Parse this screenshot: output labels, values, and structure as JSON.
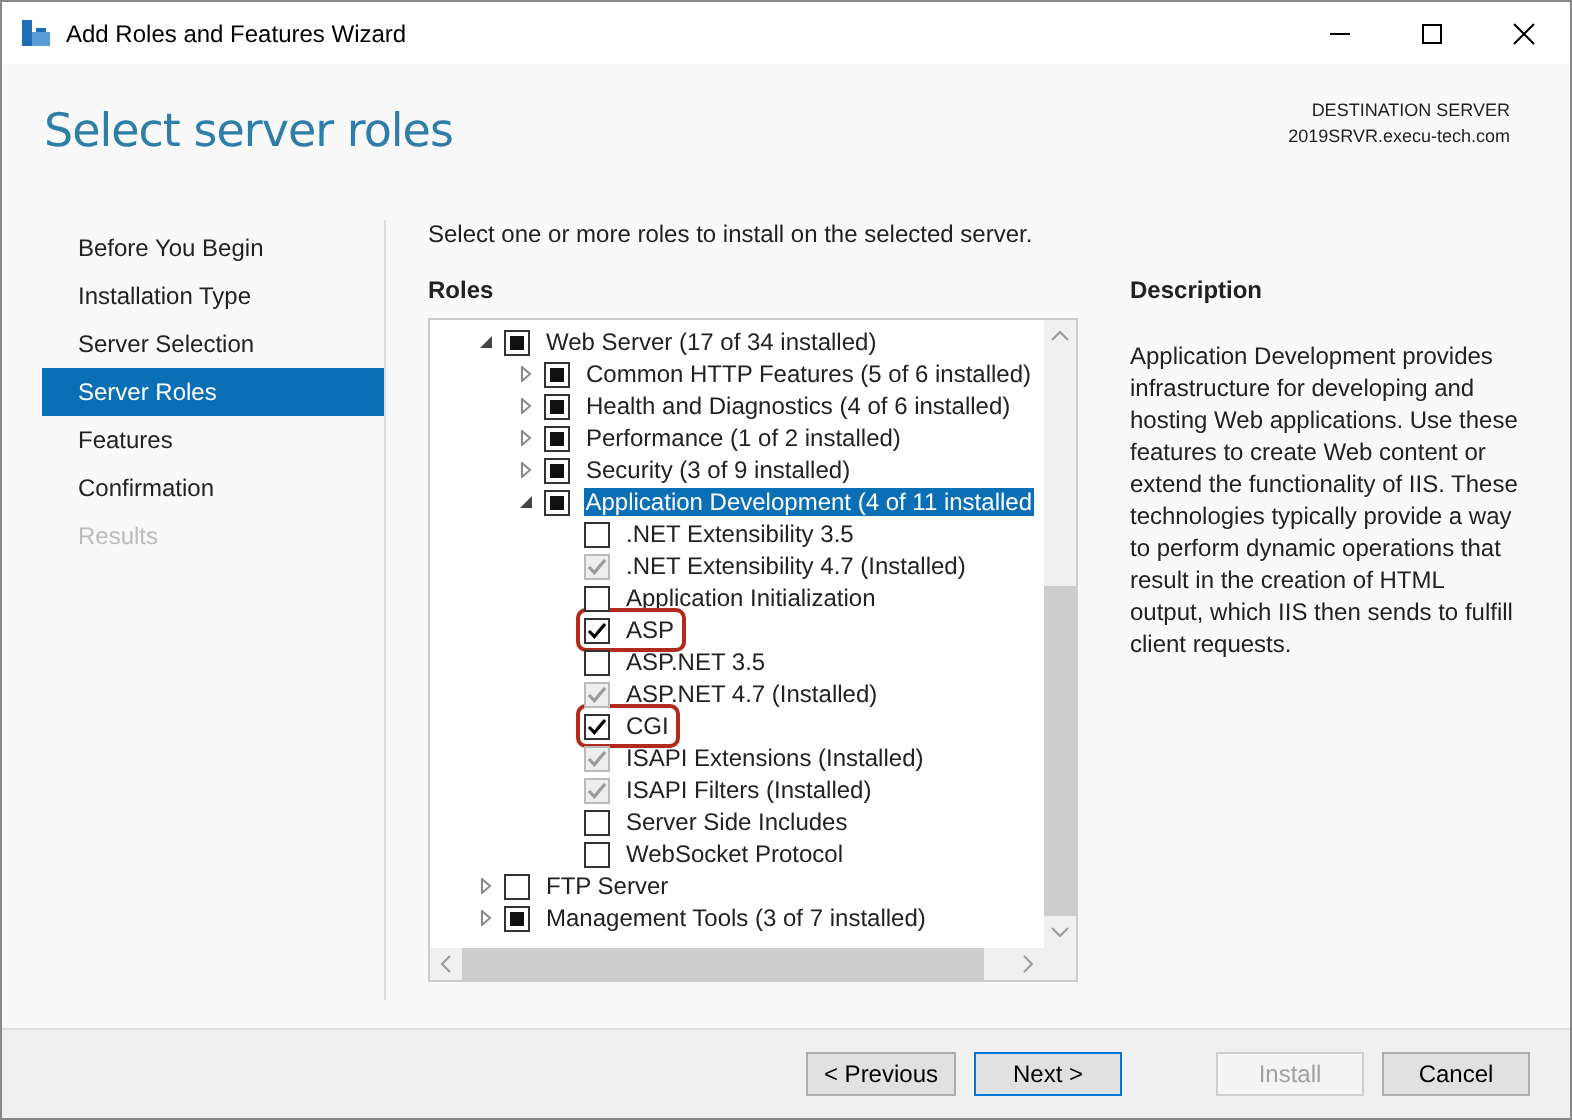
{
  "window": {
    "title": "Add Roles and Features Wizard"
  },
  "header": {
    "title": "Select server roles",
    "destination_label": "DESTINATION SERVER",
    "destination_server": "2019SRVR.execu-tech.com"
  },
  "sidebar": {
    "items": [
      {
        "label": "Before You Begin",
        "selected": false,
        "disabled": false
      },
      {
        "label": "Installation Type",
        "selected": false,
        "disabled": false
      },
      {
        "label": "Server Selection",
        "selected": false,
        "disabled": false
      },
      {
        "label": "Server Roles",
        "selected": true,
        "disabled": false
      },
      {
        "label": "Features",
        "selected": false,
        "disabled": false
      },
      {
        "label": "Confirmation",
        "selected": false,
        "disabled": false
      },
      {
        "label": "Results",
        "selected": false,
        "disabled": true
      }
    ]
  },
  "instruction": "Select one or more roles to install on the selected server.",
  "roles": {
    "heading": "Roles",
    "tree": [
      {
        "label": "Web Server (17 of 34 installed)",
        "checked": false,
        "indeterminate": true,
        "disabled": false,
        "expanded": true,
        "selected": false,
        "highlighted": false,
        "children": [
          {
            "label": "Common HTTP Features (5 of 6 installed)",
            "checked": false,
            "indeterminate": true,
            "disabled": false,
            "expanded": false,
            "selected": false,
            "highlighted": false
          },
          {
            "label": "Health and Diagnostics (4 of 6 installed)",
            "checked": false,
            "indeterminate": true,
            "disabled": false,
            "expanded": false,
            "selected": false,
            "highlighted": false
          },
          {
            "label": "Performance (1 of 2 installed)",
            "checked": false,
            "indeterminate": true,
            "disabled": false,
            "expanded": false,
            "selected": false,
            "highlighted": false
          },
          {
            "label": "Security (3 of 9 installed)",
            "checked": false,
            "indeterminate": true,
            "disabled": false,
            "expanded": false,
            "selected": false,
            "highlighted": false
          },
          {
            "label": "Application Development (4 of 11 installed",
            "checked": false,
            "indeterminate": true,
            "disabled": false,
            "expanded": true,
            "selected": true,
            "highlighted": false,
            "children": [
              {
                "label": ".NET Extensibility 3.5",
                "checked": false,
                "indeterminate": false,
                "disabled": false,
                "selected": false,
                "highlighted": false
              },
              {
                "label": ".NET Extensibility 4.7 (Installed)",
                "checked": true,
                "indeterminate": false,
                "disabled": true,
                "selected": false,
                "highlighted": false
              },
              {
                "label": "Application Initialization",
                "checked": false,
                "indeterminate": false,
                "disabled": false,
                "selected": false,
                "highlighted": false
              },
              {
                "label": "ASP",
                "checked": true,
                "indeterminate": false,
                "disabled": false,
                "selected": false,
                "highlighted": true
              },
              {
                "label": "ASP.NET 3.5",
                "checked": false,
                "indeterminate": false,
                "disabled": false,
                "selected": false,
                "highlighted": false
              },
              {
                "label": "ASP.NET 4.7 (Installed)",
                "checked": true,
                "indeterminate": false,
                "disabled": true,
                "selected": false,
                "highlighted": false
              },
              {
                "label": "CGI",
                "checked": true,
                "indeterminate": false,
                "disabled": false,
                "selected": false,
                "highlighted": true
              },
              {
                "label": "ISAPI Extensions (Installed)",
                "checked": true,
                "indeterminate": false,
                "disabled": true,
                "selected": false,
                "highlighted": false
              },
              {
                "label": "ISAPI Filters (Installed)",
                "checked": true,
                "indeterminate": false,
                "disabled": true,
                "selected": false,
                "highlighted": false
              },
              {
                "label": "Server Side Includes",
                "checked": false,
                "indeterminate": false,
                "disabled": false,
                "selected": false,
                "highlighted": false
              },
              {
                "label": "WebSocket Protocol",
                "checked": false,
                "indeterminate": false,
                "disabled": false,
                "selected": false,
                "highlighted": false
              }
            ]
          }
        ]
      },
      {
        "label": "FTP Server",
        "checked": false,
        "indeterminate": false,
        "disabled": false,
        "expanded": false,
        "selected": false,
        "highlighted": false
      },
      {
        "label": "Management Tools (3 of 7 installed)",
        "checked": false,
        "indeterminate": true,
        "disabled": false,
        "expanded": false,
        "selected": false,
        "highlighted": false
      }
    ]
  },
  "description": {
    "heading": "Description",
    "text": "Application Development provides infrastructure for developing and hosting Web applications. Use these features to create Web content or extend the functionality of IIS. These technologies typically provide a way to perform dynamic operations that result in the creation of HTML output, which IIS then sends to fulfill client requests."
  },
  "buttons": [
    {
      "label": "< Previous",
      "disabled": false,
      "focused": false
    },
    {
      "label": "Next >",
      "disabled": false,
      "focused": true
    },
    {
      "label": "Install",
      "disabled": true,
      "focused": false
    },
    {
      "label": "Cancel",
      "disabled": false,
      "focused": false
    }
  ]
}
